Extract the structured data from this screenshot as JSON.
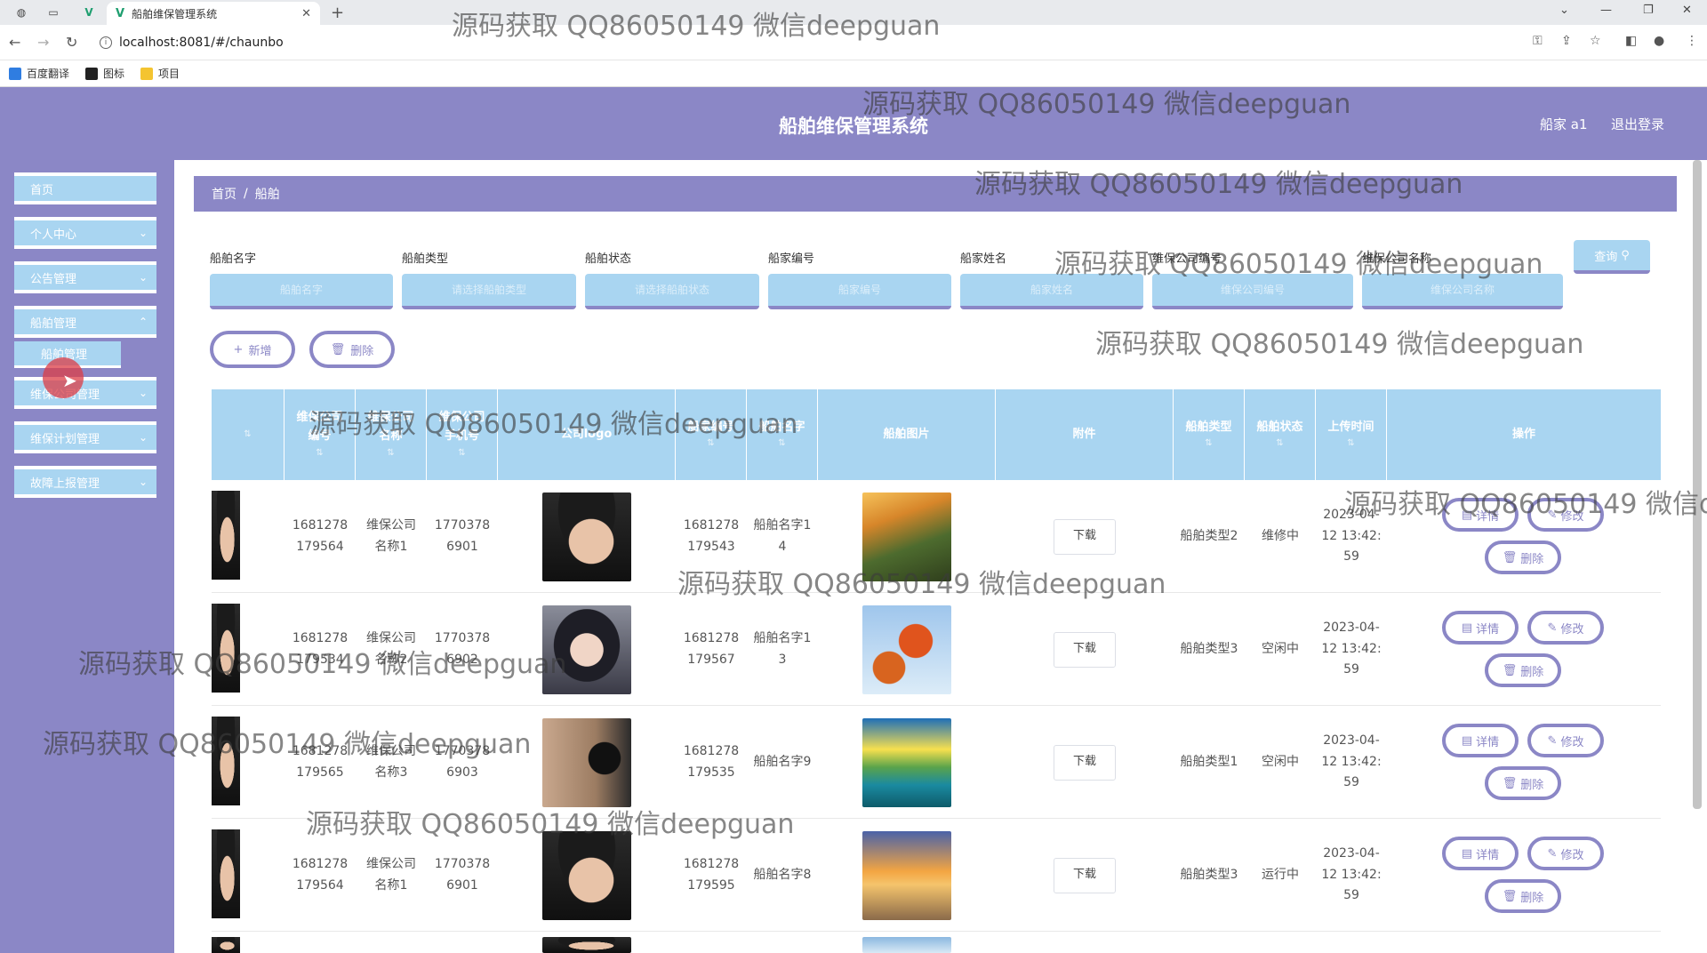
{
  "browser": {
    "tab_title": "船舶维保管理系统",
    "url": "localhost:8081/#/chaunbo",
    "bookmarks": [
      "百度翻译",
      "图标",
      "项目"
    ]
  },
  "header": {
    "title": "船舶维保管理系统",
    "user": "船家 a1",
    "logout": "退出登录"
  },
  "sidebar": {
    "items": [
      {
        "label": "首页",
        "has_arrow": false
      },
      {
        "label": "个人中心",
        "has_arrow": true
      },
      {
        "label": "公告管理",
        "has_arrow": true
      },
      {
        "label": "船舶管理",
        "has_arrow": true
      },
      {
        "label": "维保公司管理",
        "has_arrow": true
      },
      {
        "label": "维保计划管理",
        "has_arrow": true
      },
      {
        "label": "故障上报管理",
        "has_arrow": true
      }
    ],
    "submenu_label": "船舶管理"
  },
  "breadcrumb": {
    "home": "首页",
    "separator": "/",
    "current": "船舶"
  },
  "search": {
    "labels": [
      "船舶名字",
      "船舶类型",
      "船舶状态",
      "船家编号",
      "船家姓名",
      "维保公司编号",
      "维保公司名称"
    ],
    "placeholders": [
      "船舶名字",
      "请选择船舶类型",
      "请选择船舶状态",
      "船家编号",
      "船家姓名",
      "维保公司编号",
      "维保公司名称"
    ],
    "query_label": "查询"
  },
  "toolbar": {
    "add_label": "新增",
    "delete_label": "删除"
  },
  "table": {
    "headers": [
      "维保公司编号",
      "维保公司名称",
      "维保公司手机号",
      "公司logo",
      "船家编号",
      "船舶名字",
      "船舶图片",
      "附件",
      "船舶类型",
      "船舶状态",
      "上传时间",
      "操作"
    ],
    "header_lines": [
      [
        "维保公司",
        "编号"
      ],
      [
        "维保公司",
        "名称"
      ],
      [
        "维保公司",
        "手机号"
      ]
    ],
    "rows": [
      {
        "company_no": "1681278179564",
        "company_name": "维保公司名称1",
        "phone": "17703786901",
        "owner_no": "1681278179543",
        "ship_name": "船舶名字14",
        "download": "下载",
        "ship_type": "船舶类型2",
        "status": "维修中",
        "time": "2023-04-12 13:42:59"
      },
      {
        "company_no": "1681278179534",
        "company_name": "维保公司名称2",
        "phone": "17703786902",
        "owner_no": "1681278179567",
        "ship_name": "船舶名字13",
        "download": "下载",
        "ship_type": "船舶类型3",
        "status": "空闲中",
        "time": "2023-04-12 13:42:59"
      },
      {
        "company_no": "1681278179565",
        "company_name": "维保公司名称3",
        "phone": "17703786903",
        "owner_no": "1681278179535",
        "ship_name": "船舶名字9",
        "download": "下载",
        "ship_type": "船舶类型1",
        "status": "空闲中",
        "time": "2023-04-12 13:42:59"
      },
      {
        "company_no": "1681278179564",
        "company_name": "维保公司名称1",
        "phone": "17703786901",
        "owner_no": "1681278179595",
        "ship_name": "船舶名字8",
        "download": "下载",
        "ship_type": "船舶类型3",
        "status": "运行中",
        "time": "2023-04-12 13:42:59"
      }
    ],
    "actions": {
      "detail": "详情",
      "edit": "修改",
      "delete": "删除"
    }
  },
  "watermark": "源码获取 QQ86050149 微信deepguan",
  "colors": {
    "header": "#8b87c6",
    "accent_light": "#a9d5f1",
    "white": "#ffffff"
  }
}
